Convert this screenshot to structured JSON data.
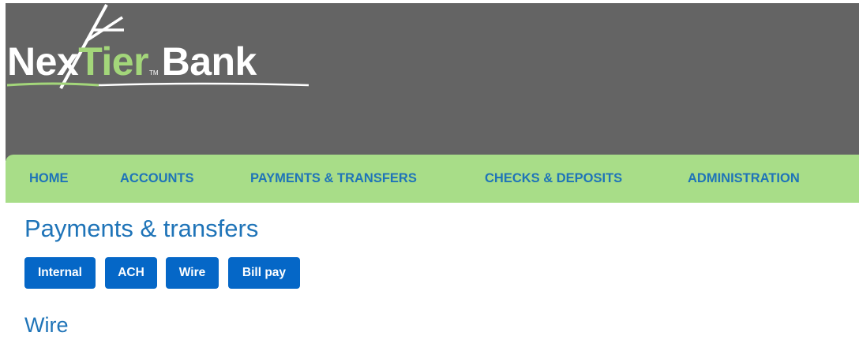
{
  "brand": {
    "logo_prefix": "Nex",
    "logo_highlight": "Tier",
    "logo_tm": "TM",
    "logo_suffix": "Bank",
    "colors": {
      "header_bg": "#646464",
      "nav_bg": "#a8dd88",
      "logo_accent": "#a3d67a",
      "link_blue": "#1f74b8",
      "button_blue": "#0567c7"
    }
  },
  "nav": {
    "items": [
      {
        "label": "HOME"
      },
      {
        "label": "ACCOUNTS"
      },
      {
        "label": "PAYMENTS & TRANSFERS"
      },
      {
        "label": "CHECKS & DEPOSITS"
      },
      {
        "label": "ADMINISTRATION"
      }
    ]
  },
  "main": {
    "title": "Payments & transfers",
    "tabs": [
      {
        "label": "Internal"
      },
      {
        "label": "ACH"
      },
      {
        "label": "Wire"
      },
      {
        "label": "Bill pay"
      }
    ],
    "section_title": "Wire"
  }
}
